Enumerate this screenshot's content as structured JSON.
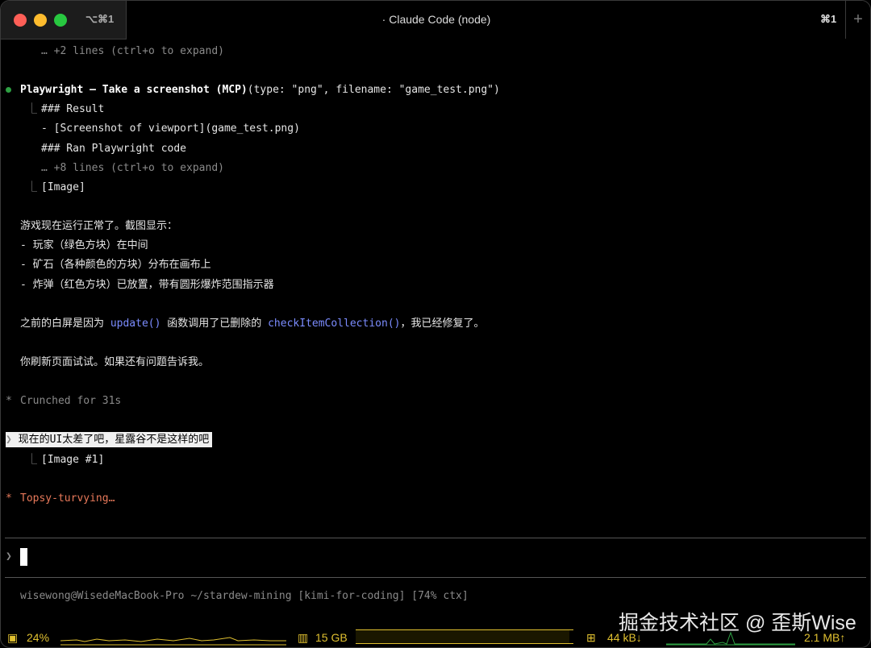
{
  "window": {
    "shortcut": "⌥⌘1",
    "title": "· Claude Code (node)",
    "right_shortcut": "⌘1",
    "new_tab": "+"
  },
  "transcript": {
    "collapsed1": "… +2 lines (ctrl+o to expand)",
    "tool_call_name": "Playwright – Take a screenshot (MCP)",
    "tool_call_args": "(type: \"png\", filename: \"game_test.png\")",
    "result_lines": [
      "### Result",
      "- [Screenshot of viewport](game_test.png)",
      "### Ran Playwright code"
    ],
    "collapsed2": "… +8 lines (ctrl+o to expand)",
    "image_tag": "[Image]",
    "para1": [
      "游戏现在运行正常了。截图显示：",
      "- 玩家（绿色方块）在中间",
      "- 矿石（各种颜色的方块）分布在画布上",
      "- 炸弹（红色方块）已放置，带有圆形爆炸范围指示器"
    ],
    "para2": {
      "pre": "之前的白屏是因为 ",
      "code1": "update()",
      "mid": " 函数调用了已删除的 ",
      "code2": "checkItemCollection()",
      "post": "，我已经修复了。"
    },
    "para3": "你刷新页面试试。如果还有问题告诉我。",
    "crunched": "Crunched for 31s",
    "user_message": "现在的UI太差了吧，星露谷不是这样的吧",
    "user_image": "[Image #1]",
    "spinner": "Topsy-turvying…"
  },
  "prompt": {
    "symbol": "❯",
    "value": ""
  },
  "status_line": "wisewong@WisedeMacBook-Pro ~/stardew-mining [kimi-for-coding] [74% ctx]",
  "system_bar": {
    "cpu": "24%",
    "memory": "15 GB",
    "net_down": "44 kB↓",
    "net_up": "2.1 MB↑",
    "memory_fraction": 0.98
  },
  "watermark": "掘金技术社区 @ 歪斯Wise",
  "colors": {
    "accent_orange": "#e8795a",
    "code_blue": "#7b8cff",
    "status_yellow": "#e0c030",
    "dot_green": "#2ea043"
  }
}
